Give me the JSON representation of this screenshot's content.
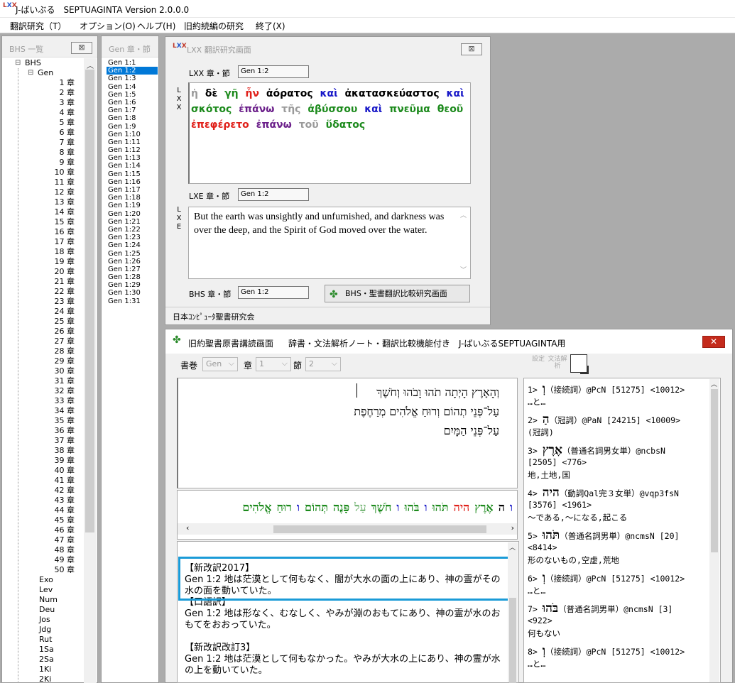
{
  "app": {
    "logo": "LXX",
    "title": "J-ばいぶる　SEPTUAGINTA Version 2.0.0.0"
  },
  "menu": [
    "翻訳研究（T）",
    "オプション(O)",
    "ヘルプ(H)",
    "旧約続編の研究",
    "終了(X)"
  ],
  "bhs_panel": {
    "caption": "BHS 一覧",
    "close_glyph": "⊠",
    "root": "BHS",
    "book": "Gen",
    "chapters": [
      "1 章",
      "2 章",
      "3 章",
      "4 章",
      "5 章",
      "6 章",
      "7 章",
      "8 章",
      "9 章",
      "10 章",
      "11 章",
      "12 章",
      "13 章",
      "14 章",
      "15 章",
      "16 章",
      "17 章",
      "18 章",
      "19 章",
      "20 章",
      "21 章",
      "22 章",
      "23 章",
      "24 章",
      "25 章",
      "26 章",
      "27 章",
      "28 章",
      "29 章",
      "30 章",
      "31 章",
      "32 章",
      "33 章",
      "34 章",
      "35 章",
      "36 章",
      "37 章",
      "38 章",
      "39 章",
      "40 章",
      "41 章",
      "42 章",
      "43 章",
      "44 章",
      "45 章",
      "46 章",
      "47 章",
      "48 章",
      "49 章",
      "50 章"
    ],
    "other_books": [
      "Exo",
      "Lev",
      "Num",
      "Deu",
      "Jos",
      "Jdg",
      "Rut",
      "1Sa",
      "2Sa",
      "1Ki",
      "2Ki"
    ]
  },
  "verse_panel": {
    "caption": "Gen 章・節",
    "selected_index": 1,
    "verses": [
      "Gen 1:1",
      "Gen 1:2",
      "Gen 1:3",
      "Gen 1:4",
      "Gen 1:5",
      "Gen 1:6",
      "Gen 1:7",
      "Gen 1:8",
      "Gen 1:9",
      "Gen 1:10",
      "Gen 1:11",
      "Gen 1:12",
      "Gen 1:13",
      "Gen 1:14",
      "Gen 1:15",
      "Gen 1:16",
      "Gen 1:17",
      "Gen 1:18",
      "Gen 1:19",
      "Gen 1:20",
      "Gen 1:21",
      "Gen 1:22",
      "Gen 1:23",
      "Gen 1:24",
      "Gen 1:25",
      "Gen 1:26",
      "Gen 1:27",
      "Gen 1:28",
      "Gen 1:29",
      "Gen 1:30",
      "Gen 1:31"
    ]
  },
  "lxx_window": {
    "title": "LXX 翻訳研究画面",
    "close_glyph": "⊠",
    "lxx_label": "LXX 章・節",
    "lxx_ref": "Gen 1:2",
    "lxx_vertical": "LXX",
    "greek_words": [
      {
        "text": "ἡ",
        "color": "#9a9a9a"
      },
      {
        "text": "δὲ",
        "color": "#000000"
      },
      {
        "text": "γῆ",
        "color": "#1c8a1c"
      },
      {
        "text": "ἦν",
        "color": "#e0201a"
      },
      {
        "text": "ἀόρατος",
        "color": "#000000"
      },
      {
        "text": "καὶ",
        "color": "#1818c8"
      },
      {
        "text": "ἀκατασκεύαστος",
        "color": "#000000"
      },
      {
        "text": "καὶ",
        "color": "#1818c8"
      },
      {
        "text": "σκότος",
        "color": "#1c8a1c"
      },
      {
        "text": "ἐπάνω",
        "color": "#6b1f8a"
      },
      {
        "text": "τῆς",
        "color": "#9a9a9a"
      },
      {
        "text": "ἀβύσσου",
        "color": "#1c8a1c"
      },
      {
        "text": "καὶ",
        "color": "#1818c8"
      },
      {
        "text": "πνεῦμα",
        "color": "#1c8a1c"
      },
      {
        "text": "θεοῦ",
        "color": "#1c8a1c"
      },
      {
        "text": "ἐπεφέρετο",
        "color": "#e0201a"
      },
      {
        "text": "ἐπάνω",
        "color": "#6b1f8a"
      },
      {
        "text": "τοῦ",
        "color": "#9a9a9a"
      },
      {
        "text": "ὕδατος",
        "color": "#1c8a1c"
      }
    ],
    "lxe_label": "LXE 章・節",
    "lxe_ref": "Gen 1:2",
    "lxe_vertical": "LXE",
    "english_text": "But the earth was unsightly and unfurnished, and darkness was over the deep, and the Spirit of God moved over the water.",
    "bhs_label": "BHS 章・節",
    "bhs_ref": "Gen 1:2",
    "compare_button": "BHS・聖書翻訳比較研究画面",
    "footer": "日本ｺﾝﾋﾟｭｰﾀ聖書研究会"
  },
  "study_window": {
    "title": "旧約聖書原書講読画面",
    "subtitle": "辞書・文法解析ノート・翻訳比較機能付き　J-ばいぶるSEPTUAGINTA用",
    "close_glyph": "✕",
    "book_label": "書巻",
    "book_value": "Gen",
    "chapter_label": "章",
    "chapter_value": "1",
    "verse_label": "節",
    "verse_value": "2",
    "tool_settings": "設定",
    "tool_grammar": "文法解析",
    "hebrew_lines": [
      "וְהָאָרֶץ הָיְתָה תֹהוּ וָבֹהוּ וְחֹשֶׁךְ",
      "עַל־פְּנֵי תְהוֹם וְרוּחַ אֱלֹהִים מְרַחֶפֶת",
      "עַל־פְּנֵי הַמָּיִם"
    ],
    "word_strip": [
      {
        "text": "ו",
        "color": "#1818c8"
      },
      {
        "text": "ה",
        "color": "#000000"
      },
      {
        "text": "אֶרֶץ",
        "color": "#1c8a1c"
      },
      {
        "text": "היה",
        "color": "#e0201a"
      },
      {
        "text": "תֹּהוּ",
        "color": "#1c8a1c"
      },
      {
        "text": "ו",
        "color": "#1818c8"
      },
      {
        "text": "בֹּהוּ",
        "color": "#1c8a1c"
      },
      {
        "text": "ו",
        "color": "#1818c8"
      },
      {
        "text": "חֹשֶׁךְ",
        "color": "#1c8a1c"
      },
      {
        "text": "עַל",
        "color": "#7ab87a"
      },
      {
        "text": "פָּנֶה",
        "color": "#1c8a1c"
      },
      {
        "text": "תְּהוֹם",
        "color": "#1c8a1c"
      },
      {
        "text": "ו",
        "color": "#1818c8"
      },
      {
        "text": "רוּחַ",
        "color": "#1c8a1c"
      },
      {
        "text": "אֱלֹהִים",
        "color": "#1c8a1c"
      }
    ],
    "translations": [
      {
        "title": "【新改訳2017】",
        "text": "Gen 1:2 地は茫漠として何もなく、闇が大水の面の上にあり、神の霊がその水の面を動いていた。"
      },
      {
        "title": "【口語訳】",
        "text": "Gen 1:2 地は形なく、むなしく、やみが淵のおもてにあり、神の霊が水のおもてをおおっていた。"
      },
      {
        "title": "【新改訳改訂3】",
        "text": "Gen 1:2 地は茫漠として何もなかった。やみが大水の上にあり、神の霊が水の上を動いていた。"
      }
    ],
    "analysis": [
      {
        "line1_prefix": "1> ",
        "word": "וְ",
        "line1_suffix": "（接続詞）@PcN [51275] <10012>",
        "line2": "…と…"
      },
      {
        "line1_prefix": "2> ",
        "word": "הַ",
        "line1_suffix": "（冠詞）@PaN [24215] <10009>",
        "line2": "(冠詞)"
      },
      {
        "line1_prefix": "3> ",
        "word": "אֶרֶץ",
        "line1_suffix": "（普通名詞男女単）@ncbsN",
        "line2": "[2505] <776>",
        "line3": "地,土地,国"
      },
      {
        "line1_prefix": "4> ",
        "word": "היה",
        "line1_suffix": "（動詞Qal完３女単）@vqp3fsN",
        "line2": "[3576] <1961>",
        "line3": "～である,～になる,起こる"
      },
      {
        "line1_prefix": "5> ",
        "word": "תֹּהוּ",
        "line1_suffix": "（普通名詞男単）@ncmsN [20]",
        "line2": "<8414>",
        "line3": "形のないもの,空虚,荒地"
      },
      {
        "line1_prefix": "6> ",
        "word": "וְ",
        "line1_suffix": "（接続詞）@PcN [51275] <10012>",
        "line2": "…と…"
      },
      {
        "line1_prefix": "7> ",
        "word": "בֹּהוּ",
        "line1_suffix": "（普通名詞男単）@ncmsN [3]",
        "line2": "<922>",
        "line3": "何もない"
      },
      {
        "line1_prefix": "8> ",
        "word": "וְ",
        "line1_suffix": "（接続詞）@PcN [51275] <10012>",
        "line2": "…と…"
      }
    ]
  }
}
